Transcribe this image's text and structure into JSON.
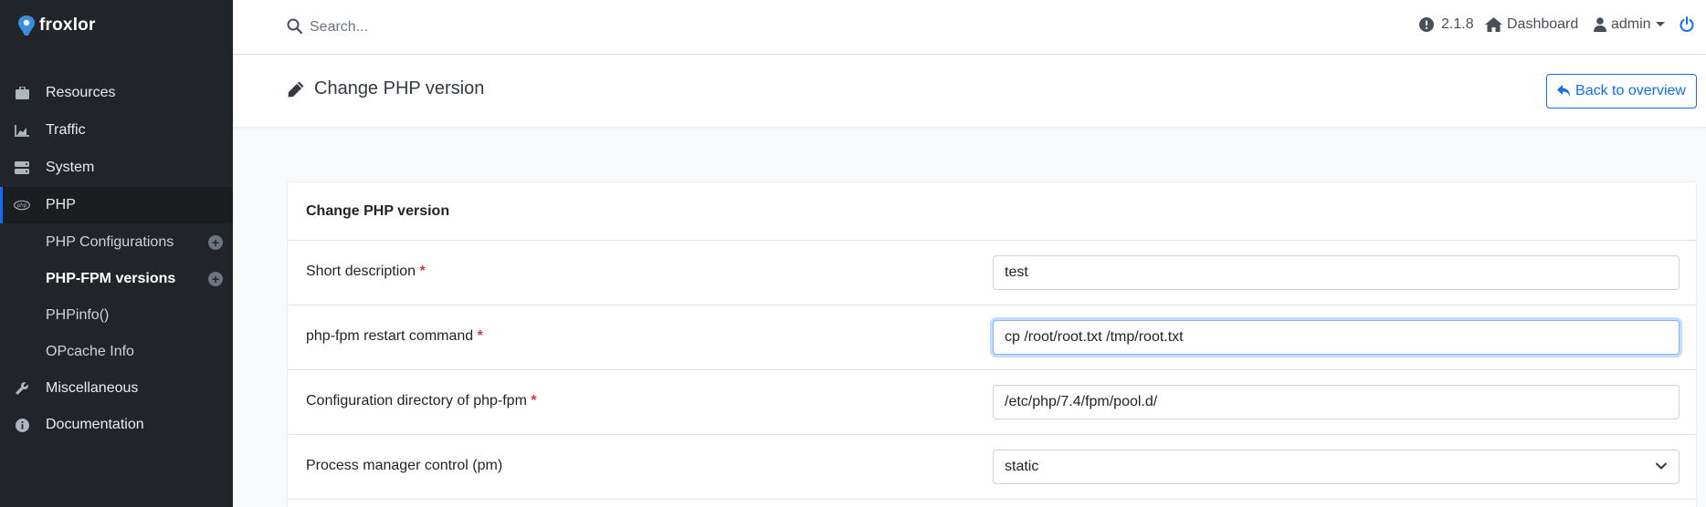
{
  "app": {
    "name": "froxlor"
  },
  "sidebar": {
    "items": [
      {
        "label": "Resources",
        "icon": "briefcase-icon"
      },
      {
        "label": "Traffic",
        "icon": "chart-area-icon"
      },
      {
        "label": "System",
        "icon": "server-icon"
      },
      {
        "label": "PHP",
        "icon": "php-icon"
      },
      {
        "label": "Miscellaneous",
        "icon": "wrench-icon"
      },
      {
        "label": "Documentation",
        "icon": "info-icon"
      }
    ],
    "php_sub": [
      {
        "label": "PHP Configurations"
      },
      {
        "label": "PHP-FPM versions"
      },
      {
        "label": "PHPinfo()"
      },
      {
        "label": "OPcache Info"
      }
    ]
  },
  "topbar": {
    "search_placeholder": "Search...",
    "version": "2.1.8",
    "dashboard": "Dashboard",
    "user": "admin"
  },
  "page": {
    "title": "Change PHP version",
    "back_button": "Back to overview"
  },
  "form": {
    "title": "Change PHP version",
    "fields": [
      {
        "label": "Short description",
        "value": "test"
      },
      {
        "label": "php-fpm restart command",
        "value": "cp /root/root.txt /tmp/root.txt"
      },
      {
        "label": "Configuration directory of php-fpm",
        "value": "/etc/php/7.4/fpm/pool.d/"
      },
      {
        "label": "Process manager control (pm)",
        "value": "static"
      }
    ],
    "required_mark": "*"
  },
  "colors": {
    "sidebar_bg": "#212529",
    "accent": "#0d6efd",
    "required": "#dc3545"
  }
}
